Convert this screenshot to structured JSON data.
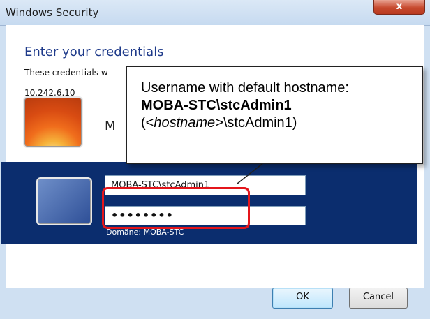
{
  "window": {
    "title": "Windows Security",
    "close_label": "x"
  },
  "dialog": {
    "heading": "Enter your credentials",
    "subtext": "These credentials w",
    "host": "10.242.6.10"
  },
  "user_tiles": {
    "other_user_partial_name": "M",
    "domain": "Domäne: MOBA-STC"
  },
  "inputs": {
    "username_value": "MOBA-STC\\stcAdmin1",
    "password_value": "••••••••"
  },
  "buttons": {
    "ok_label": "OK",
    "cancel_label": "Cancel"
  },
  "callout": {
    "line1": "Username with default hostname:",
    "line2": "MOBA-STC\\stcAdmin1",
    "line3_open": "(<",
    "line3_hostname": "hostname",
    "line3_close": ">\\stcAdmin1)"
  },
  "colors": {
    "selected_tile_bg": "#0b2d6e",
    "highlight_border": "#e4151b",
    "heading_text": "#1e3a8a"
  }
}
